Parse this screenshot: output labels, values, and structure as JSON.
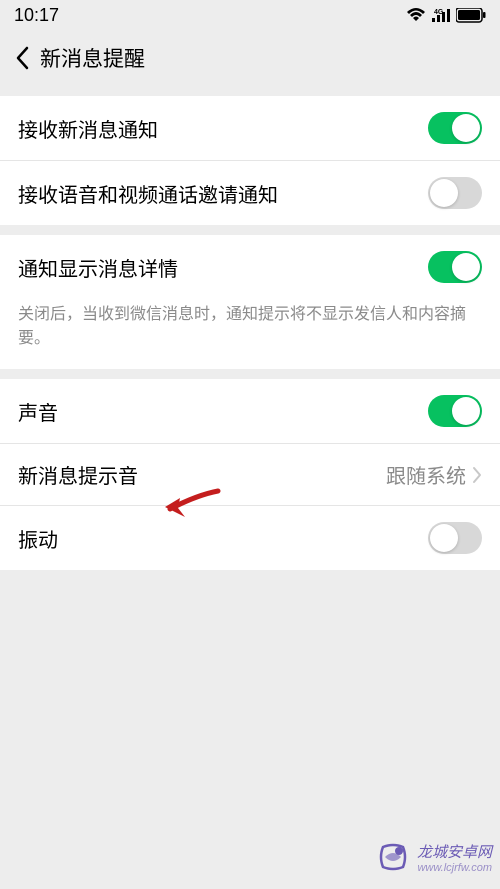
{
  "statusBar": {
    "time": "10:17"
  },
  "header": {
    "title": "新消息提醒"
  },
  "sections": {
    "section1": {
      "row1": {
        "label": "接收新消息通知",
        "toggle": true
      },
      "row2": {
        "label": "接收语音和视频通话邀请通知",
        "toggle": false
      }
    },
    "section2": {
      "row1": {
        "label": "通知显示消息详情",
        "toggle": true,
        "description": "关闭后，当收到微信消息时，通知提示将不显示发信人和内容摘要。"
      }
    },
    "section3": {
      "row1": {
        "label": "声音",
        "toggle": true
      },
      "row2": {
        "label": "新消息提示音",
        "value": "跟随系统"
      },
      "row3": {
        "label": "振动",
        "toggle": false
      }
    }
  },
  "watermark": {
    "name": "龙城安卓网",
    "url": "www.lcjrfw.com"
  }
}
